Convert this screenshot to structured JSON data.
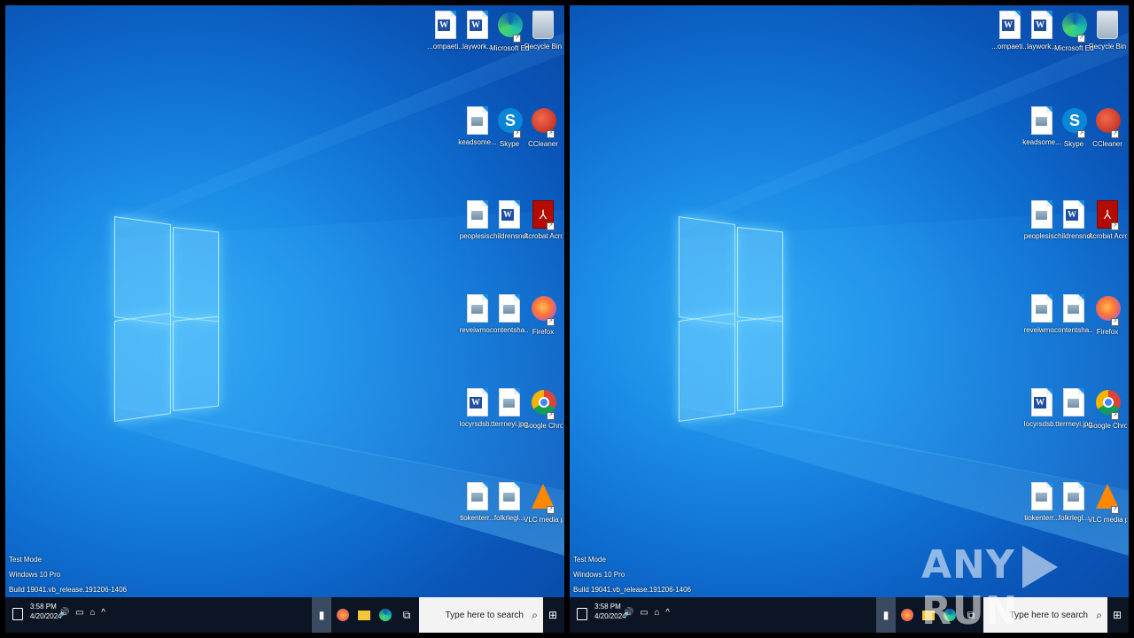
{
  "panes": [
    {
      "id": "left",
      "desktop_icons": [
        {
          "label": "Recycle Bin",
          "icon": "recycle-bin-icon"
        },
        {
          "label": "Microsoft Edge",
          "icon": "edge-icon"
        },
        {
          "label": "laywork...",
          "icon": "word-doc-icon"
        },
        {
          "label": "...ompaeti...",
          "icon": "word-doc-icon"
        },
        {
          "label": "CCleaner",
          "icon": "ccleaner-icon"
        },
        {
          "label": "Skype",
          "icon": "skype-icon"
        },
        {
          "label": "keadsome...",
          "icon": "image-doc-icon"
        },
        {
          "label": "Acrobat Acrobat",
          "icon": "acrobat-icon"
        },
        {
          "label": "childrensnot...",
          "icon": "word-doc-icon"
        },
        {
          "label": "peoplesis...",
          "icon": "image-doc-icon"
        },
        {
          "label": "Firefox",
          "icon": "firefox-icon"
        },
        {
          "label": "contentsha...",
          "icon": "image-doc-icon"
        },
        {
          "label": "reveiwmo...",
          "icon": "image-doc-icon"
        },
        {
          "label": "Google Chrome",
          "icon": "chrome-icon"
        },
        {
          "label": "tterrneyi.jpg",
          "icon": "image-doc-icon"
        },
        {
          "label": "locyrsdsb...",
          "icon": "word-doc-icon"
        },
        {
          "label": "VLC media player",
          "icon": "vlc-icon"
        },
        {
          "label": "folkrlegl...",
          "icon": "image-doc-icon"
        },
        {
          "label": "tiokenterr...",
          "icon": "image-doc-icon"
        }
      ]
    }
  ],
  "watermark": {
    "line1": "Test Mode",
    "line2": "Windows 10 Pro",
    "line3": "Build 19041.vb_release.191206-1406"
  },
  "taskbar": {
    "search_placeholder": "Type here to search",
    "time": "3:58 PM",
    "date": "4/20/2024"
  },
  "brand": {
    "left": "ANY",
    "right": "RUN"
  },
  "colors": {
    "desktop_blue": "#1b8ce6",
    "taskbar": "#0b1523"
  }
}
